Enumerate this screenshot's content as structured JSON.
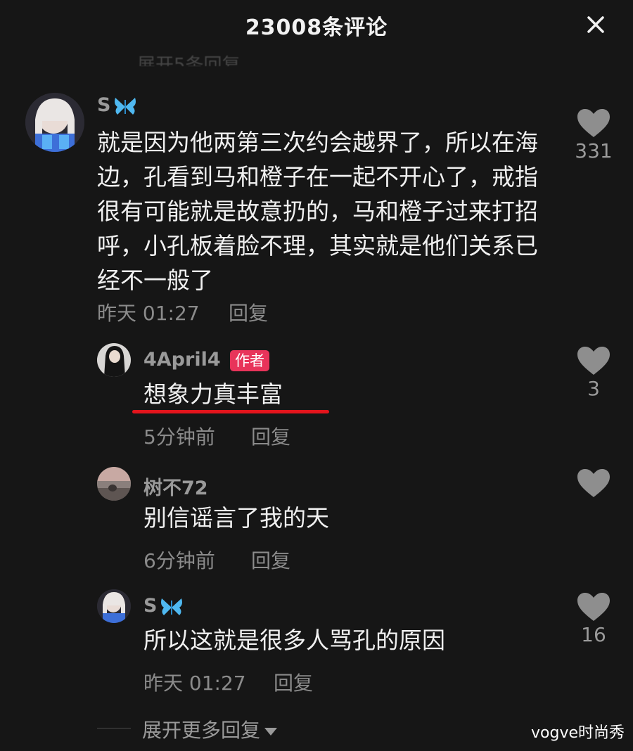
{
  "header": {
    "title": "23008条评论",
    "close_icon": "close-icon"
  },
  "faded_top_text": "展开5条回复",
  "comments": [
    {
      "username": "S",
      "username_icon": "butterfly-icon",
      "text": "就是因为他两第三次约会越界了，所以在海边，孔看到马和橙子在一起不开心了，戒指很有可能就是故意扔的，马和橙子过来打招呼，小孔板着脸不理，其实就是他们关系已经不一般了",
      "time": "昨天 01:27",
      "reply_label": "回复",
      "likes": "331"
    }
  ],
  "replies": [
    {
      "username": "4April4",
      "badge": "作者",
      "text": "想象力真丰富",
      "time": "5分钟前",
      "reply_label": "回复",
      "likes": "3"
    },
    {
      "username": "树不72",
      "text": "别信谣言了我的天",
      "time": "6分钟前",
      "reply_label": "回复",
      "likes": ""
    },
    {
      "username": "S",
      "username_icon": "butterfly-icon",
      "text": "所以这就是很多人骂孔的原因",
      "time": "昨天 01:27",
      "reply_label": "回复",
      "likes": "16"
    }
  ],
  "expand_more": "展开更多回复",
  "watermark": "vogve时尚秀",
  "colors": {
    "background": "#161616",
    "badge": "#e8345a",
    "underline": "#e3141c",
    "butterfly": "#4fb8f0",
    "like_icon": "#8e8e8e"
  }
}
